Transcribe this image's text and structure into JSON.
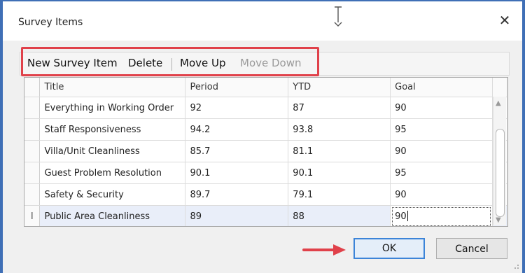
{
  "window": {
    "title": "Survey Items"
  },
  "toolbar": {
    "new_item": "New Survey Item",
    "delete": "Delete",
    "move_up": "Move Up",
    "move_down": "Move Down"
  },
  "grid": {
    "columns": [
      "Title",
      "Period",
      "YTD",
      "Goal"
    ],
    "rows": [
      {
        "title": "Everything in Working Order",
        "period": "92",
        "ytd": "87",
        "goal": "90",
        "marker": ""
      },
      {
        "title": "Staff Responsiveness",
        "period": "94.2",
        "ytd": "93.8",
        "goal": "95",
        "marker": ""
      },
      {
        "title": "Villa/Unit Cleanliness",
        "period": "85.7",
        "ytd": "81.1",
        "goal": "90",
        "marker": ""
      },
      {
        "title": "Guest Problem Resolution",
        "period": "90.1",
        "ytd": "90.1",
        "goal": "95",
        "marker": ""
      },
      {
        "title": "Safety & Security",
        "period": "89.7",
        "ytd": "79.1",
        "goal": "90",
        "marker": ""
      },
      {
        "title": "Public Area Cleanliness",
        "period": "89",
        "ytd": "88",
        "goal": "90",
        "marker": "I"
      }
    ],
    "selected_row_index": 5,
    "editing_column": "goal"
  },
  "buttons": {
    "ok": "OK",
    "cancel": "Cancel"
  },
  "colors": {
    "highlight_box": "#e0414a",
    "ok_border": "#3c84d8",
    "window_frame": "#3f6fb6",
    "annotation_arrow": "#e0414a"
  },
  "icons": [
    "close-icon",
    "text-cursor-icon",
    "scroll-up-icon",
    "scroll-down-icon",
    "red-arrow-icon",
    "resize-grip-icon"
  ]
}
